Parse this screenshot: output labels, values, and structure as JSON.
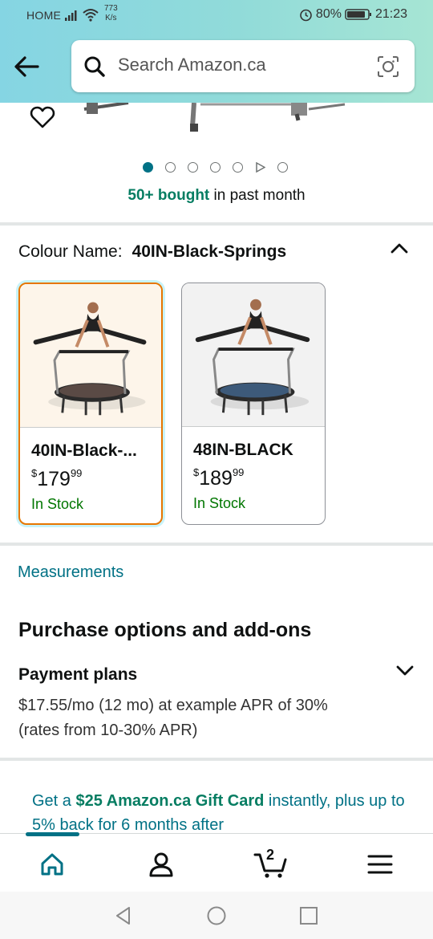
{
  "status_bar": {
    "carrier": "HOME",
    "speed_value": "773",
    "speed_unit": "K/s",
    "battery": "80%",
    "time": "21:23"
  },
  "search": {
    "placeholder": "Search Amazon.ca"
  },
  "product": {
    "image_count_dots": 7,
    "active_dot": 0,
    "bought_highlight": "50+ bought",
    "bought_rest": " in past month"
  },
  "variations": {
    "label": "Colour Name:",
    "selected_value": "40IN-Black-Springs",
    "options": [
      {
        "name": "40IN-Black-...",
        "currency": "$",
        "price_whole": "179",
        "price_cents": "99",
        "stock": "In Stock"
      },
      {
        "name": "48IN-BLACK",
        "currency": "$",
        "price_whole": "189",
        "price_cents": "99",
        "stock": "In Stock"
      }
    ]
  },
  "measurements_link": "Measurements",
  "purchase_options": {
    "title": "Purchase options and add-ons",
    "payment_title": "Payment plans",
    "payment_body": "$17.55/mo (12 mo) at example APR of 30% (rates from 10-30% APR)"
  },
  "gift_offer": {
    "prefix": "Get a ",
    "highlight": "$25 Amazon.ca Gift Card",
    "suffix": " instantly, plus up to 5% back for 6 months after"
  },
  "bottom_nav": {
    "cart_count": "2",
    "items": [
      "home-icon",
      "account-icon",
      "cart-icon",
      "menu-icon"
    ]
  },
  "colors": {
    "teal": "#007185",
    "green": "#067d62",
    "in_stock": "#007600",
    "selected_border": "#e77600"
  }
}
